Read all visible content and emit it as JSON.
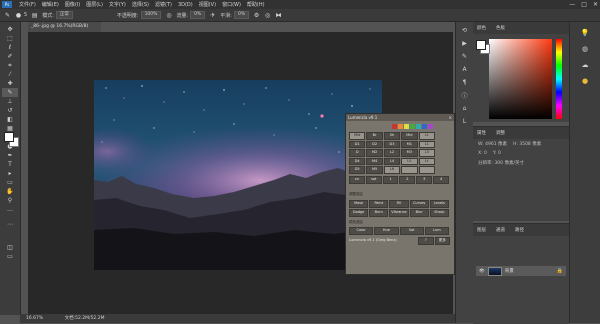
{
  "menubar": {
    "app_icon": "Ps",
    "items": [
      "文件(F)",
      "编辑(E)",
      "图像(I)",
      "图层(L)",
      "文字(Y)",
      "选择(S)",
      "滤镜(T)",
      "3D(D)",
      "视图(V)",
      "窗口(W)",
      "帮助(H)"
    ],
    "window_controls": [
      "—",
      "□",
      "✕"
    ]
  },
  "options": {
    "brush_size": "5",
    "mode_label": "模式:",
    "mode_value": "正常",
    "opacity_label": "不透明度:",
    "opacity_value": "100%",
    "flow_label": "流量:",
    "flow_value": "0%",
    "smooth_label": "平滑:",
    "smooth_value": "0%"
  },
  "document": {
    "tab_title": "_86-.jpg @ 16.7%(RGB/8)",
    "zoom": "16.67%",
    "status": "文档:52.2M/52.2M"
  },
  "plugin": {
    "title": "Lumenzia v9.1",
    "close": "×",
    "buttons_grid": [
      [
        "Mid",
        "Br",
        "Sh",
        "Mid",
        "Lt"
      ],
      [
        "D1",
        "D2",
        "D3",
        "M1",
        "L1"
      ],
      [
        "D",
        "M2",
        "L2",
        "M3",
        "L3"
      ],
      [
        "D4",
        "M4",
        "L4",
        "L5",
        "Lt"
      ],
      [
        "D5",
        "M5",
        "L6",
        "",
        ""
      ]
    ],
    "row2": [
      "zn",
      "sat",
      "1",
      "2",
      "3",
      "4"
    ],
    "section_labels": [
      "调整选区",
      "颜色选区"
    ],
    "actions_row1": [
      "Mask",
      "Paint",
      "Fill",
      "Curves",
      "Levels"
    ],
    "actions_row2": [
      "Dodge",
      "Burn",
      "Vibrance",
      "Blur",
      "Sharp"
    ],
    "actions_row3": [
      "Color",
      "Hue",
      "Sat",
      "Lum"
    ],
    "footer": "Lumenzia v9.1 (Greg Benz)",
    "footer_buttons": [
      "?",
      "更多"
    ]
  },
  "panels": {
    "color_tabs": [
      "颜色",
      "色板"
    ],
    "properties_tabs": [
      "属性",
      "调整"
    ],
    "properties_rows": [
      [
        "W: 4961 像素",
        "H: 3508 像素"
      ],
      [
        "X: 0",
        "Y: 0"
      ],
      [
        "分辨率: 300 像素/英寸"
      ]
    ],
    "layers_tabs": [
      "图层",
      "通道",
      "路径"
    ],
    "layer_name": "背景"
  },
  "toolbar": {
    "tools": [
      "move-tool",
      "marquee-tool",
      "lasso-tool",
      "quick-select-tool",
      "crop-tool",
      "eyedropper-tool",
      "healing-tool",
      "brush-tool",
      "stamp-tool",
      "history-brush-tool",
      "eraser-tool",
      "gradient-tool",
      "blur-tool",
      "dodge-tool",
      "pen-tool",
      "text-tool",
      "path-select-tool",
      "shape-tool",
      "hand-tool",
      "zoom-tool",
      "more-tools"
    ]
  },
  "colors": {
    "menubar_bg": "#323232",
    "panel_bg": "#424242",
    "canvas_bg": "#282828",
    "accent_blue": "#2a6db3",
    "picker_hue": "#ff3a10"
  }
}
